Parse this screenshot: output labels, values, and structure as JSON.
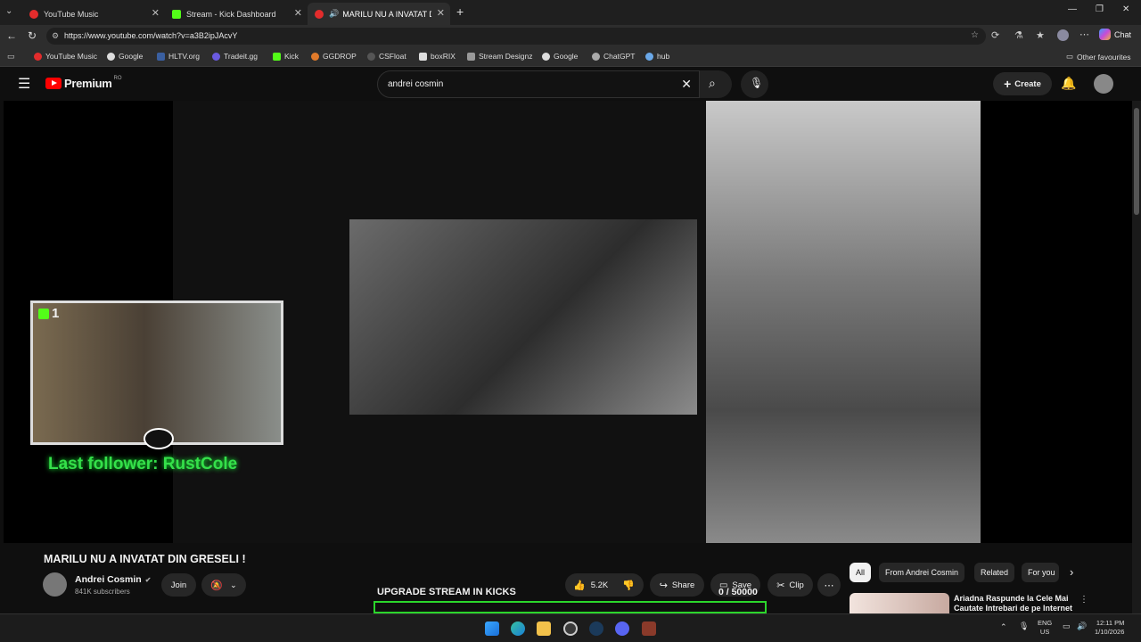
{
  "browser": {
    "tabs": [
      {
        "label": "YouTube Music",
        "color": "#e32c2c"
      },
      {
        "label": "Stream - Kick Dashboard",
        "color": "#53fc18"
      },
      {
        "label": "MARILU NU A INVATAT DIN G",
        "color": "#e32c2c"
      }
    ],
    "url": "https://www.youtube.com/watch?v=a3B2ipJAcvY",
    "bookmarks": [
      "YouTube Music",
      "Google",
      "HLTV.org",
      "Tradeit.gg",
      "Kick",
      "GGDROP",
      "CSFloat",
      "boxRIX",
      "Stream Designz",
      "Google",
      "ChatGPT",
      "hub"
    ],
    "other_favourites": "Other favourites",
    "chat_label": "Chat"
  },
  "youtube": {
    "logo_text": "Premium",
    "region": "RO",
    "search_query": "andrei cosmin",
    "create_label": "Create"
  },
  "overlay": {
    "kick_badge": "1",
    "last_follower": "Last follower: RustCole"
  },
  "video": {
    "title": "MARILU NU A INVATAT DIN GRESELI !",
    "channel": "Andrei Cosmin",
    "subscribers": "841K subscribers",
    "join_label": "Join",
    "likes": "5.2K",
    "share_label": "Share",
    "save_label": "Save",
    "clip_label": "Clip"
  },
  "stream_goal": {
    "label": "UPGRADE STREAM IN KICKS",
    "progress_text": "0 / 50000",
    "current": 0,
    "target": 50000
  },
  "chips": [
    "All",
    "From Andrei Cosmin",
    "Related",
    "For you"
  ],
  "recommendation": {
    "title": "Ariadna Raspunde la Cele Mai Cautate Intrebari de pe Internet"
  },
  "taskbar": {
    "lang": "ENG",
    "region": "US",
    "time": "12:11 PM",
    "date": "1/10/2026"
  }
}
